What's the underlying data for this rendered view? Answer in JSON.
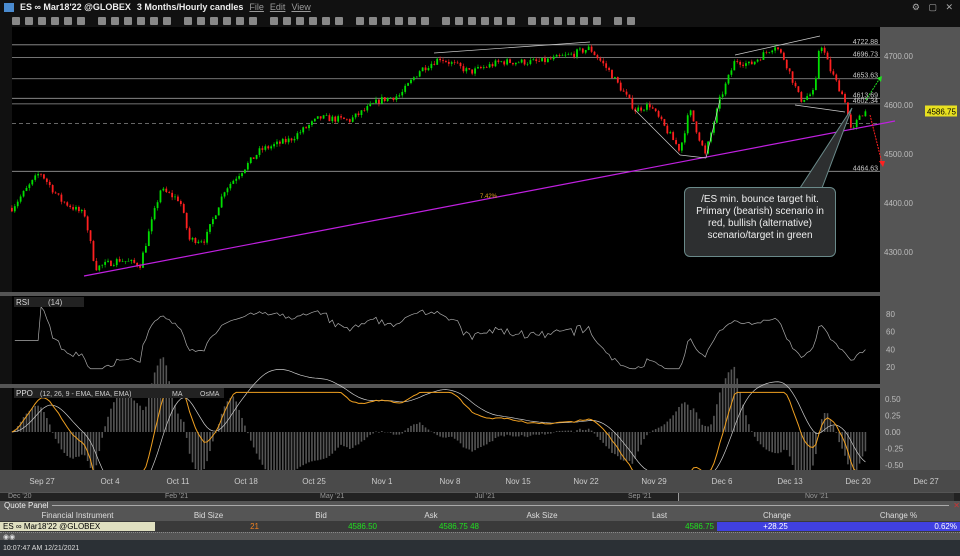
{
  "window": {
    "symbol": "ES ∞ Mar18'22 @GLOBEX",
    "timeframe": "3 Months/Hourly candles",
    "menus": [
      "File",
      "Edit",
      "View"
    ]
  },
  "price_axis": {
    "ticks": [
      "4700.00",
      "4600.00",
      "4500.00",
      "4400.00",
      "4300.00"
    ],
    "last_price": "4586.75",
    "levels": [
      "4722.88",
      "4696.73",
      "4653.63",
      "4613.69",
      "4602.34",
      "4464.63"
    ],
    "trendline_label": "7.42%"
  },
  "rsi": {
    "label": "RSI",
    "params": "(14)",
    "ticks": [
      "80",
      "60",
      "40",
      "20"
    ]
  },
  "ppo": {
    "label": "PPO",
    "params": "(12, 26, 9 - EMA, EMA, EMA)",
    "ma": "MA",
    "osma": "OsMA",
    "ticks": [
      "0.50",
      "0.25",
      "0.00",
      "-0.25",
      "-0.50"
    ]
  },
  "date_axis": [
    "Sep 27",
    "Oct 4",
    "Oct 11",
    "Oct 18",
    "Oct 25",
    "Nov 1",
    "Nov 8",
    "Nov 15",
    "Nov 22",
    "Nov 29",
    "Dec 6",
    "Dec 13",
    "Dec 20",
    "Dec 27"
  ],
  "scroll_labels": [
    "Dec '20",
    "Feb '21",
    "May '21",
    "Jul '21",
    "Sep '21",
    "Nov '21"
  ],
  "annotation": "/ES min. bounce target hit.\nPrimary (bearish) scenario in\nred, bullish (alternative)\nscenario/target in green",
  "quote_panel": {
    "title": "Quote Panel",
    "columns": [
      "Financial Instrument",
      "Bid Size",
      "Bid",
      "Ask",
      "Ask Size",
      "Last",
      "Change",
      "Change %"
    ],
    "row": {
      "instrument": "ES ∞ Mar18'22 @GLOBEX",
      "bid_size": "21",
      "bid": "4586.50",
      "ask": "4586.75 48",
      "ask_size": "",
      "last": "4586.75",
      "change": "+28.25",
      "change_pct": "0.62%"
    }
  },
  "status": {
    "time": "10:07:47 AM 12/21/2021"
  },
  "colors": {
    "up": "#00e000",
    "down": "#ff2020",
    "trendline": "#c020e0",
    "ppo": "#f0a020",
    "accent": "#4040e0"
  },
  "chart_data": {
    "type": "candlestick",
    "x_unit": "days from Sep 27",
    "ylim": [
      4230,
      4760
    ],
    "path": [
      [
        -3.1,
        4390
      ],
      [
        -0.2,
        4463
      ],
      [
        1.9,
        4406
      ],
      [
        4.4,
        4376
      ],
      [
        5.5,
        4268
      ],
      [
        8,
        4284
      ],
      [
        10.1,
        4274
      ],
      [
        12.2,
        4427
      ],
      [
        14.2,
        4406
      ],
      [
        15.2,
        4325
      ],
      [
        16.8,
        4325
      ],
      [
        18.8,
        4427
      ],
      [
        22.5,
        4508
      ],
      [
        25.5,
        4529
      ],
      [
        28.6,
        4574
      ],
      [
        31.7,
        4569
      ],
      [
        34.8,
        4610
      ],
      [
        36.9,
        4620
      ],
      [
        38.9,
        4671
      ],
      [
        41,
        4696
      ],
      [
        44.1,
        4667
      ],
      [
        47.2,
        4688
      ],
      [
        51.3,
        4688
      ],
      [
        54.4,
        4702
      ],
      [
        56.4,
        4716
      ],
      [
        58.5,
        4667
      ],
      [
        61.1,
        4590
      ],
      [
        62.6,
        4600
      ],
      [
        65.7,
        4508
      ],
      [
        66.7,
        4590
      ],
      [
        68.3,
        4498
      ],
      [
        69.8,
        4610
      ],
      [
        71.4,
        4692
      ],
      [
        72.9,
        4682
      ],
      [
        75.5,
        4722
      ],
      [
        76.5,
        4692
      ],
      [
        78.1,
        4610
      ],
      [
        79.6,
        4627
      ],
      [
        80.1,
        4733
      ],
      [
        81.2,
        4671
      ],
      [
        82.7,
        4610
      ],
      [
        83.4,
        4540
      ],
      [
        84.2,
        4580
      ],
      [
        84.9,
        4587
      ]
    ]
  }
}
